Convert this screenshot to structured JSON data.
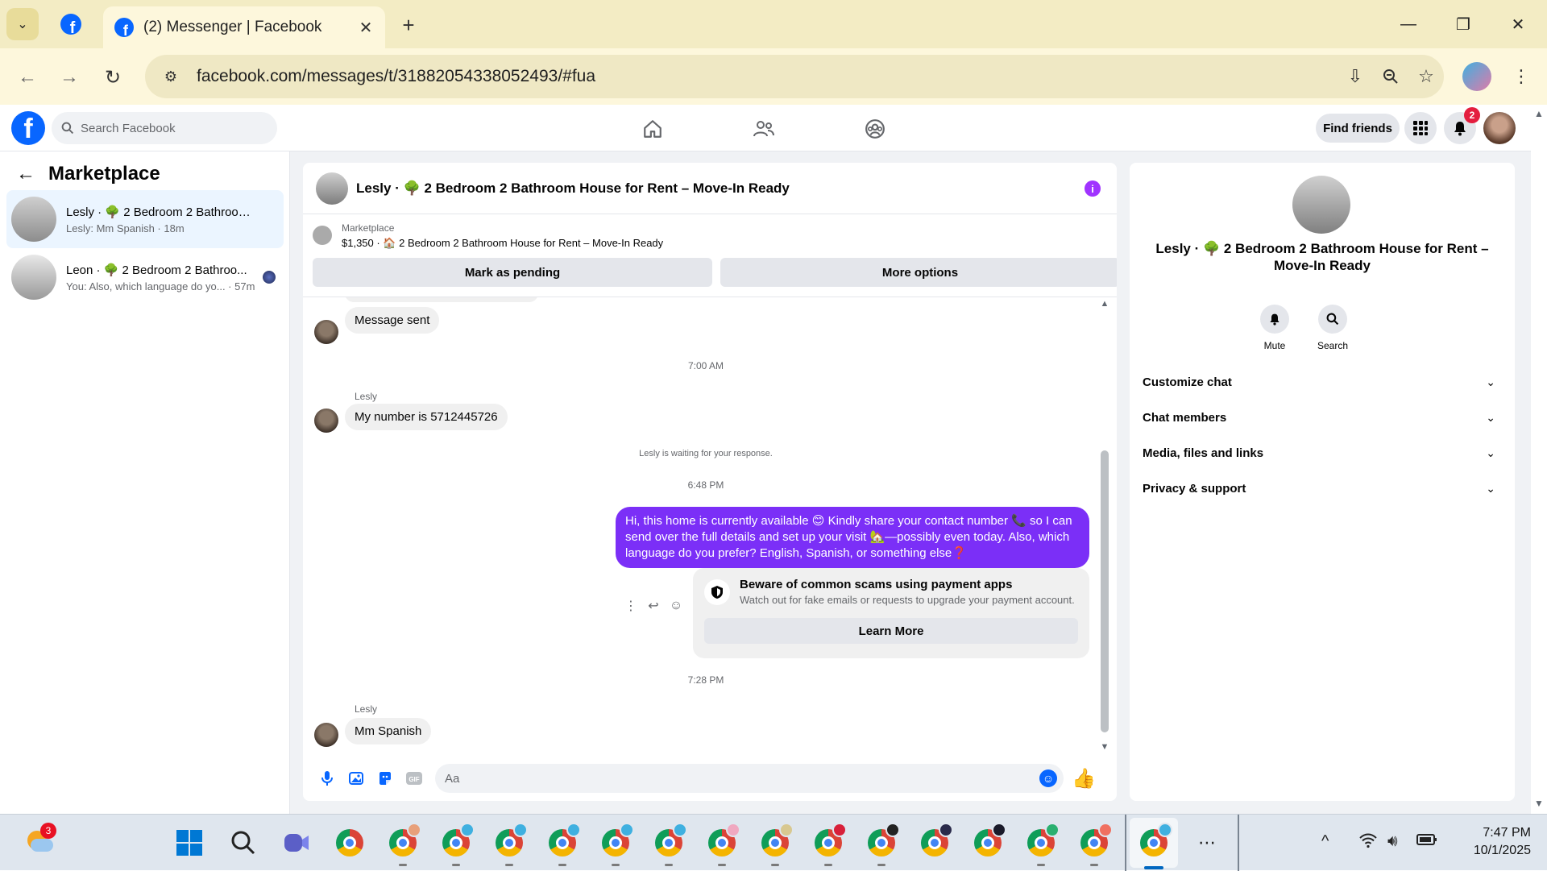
{
  "browser": {
    "tab_title": "(2) Messenger | Facebook",
    "url": "facebook.com/messages/t/31882054338052493/#fua"
  },
  "fb": {
    "search_placeholder": "Search Facebook",
    "find_friends": "Find friends",
    "notif_count": "2"
  },
  "left": {
    "title": "Marketplace",
    "conversations": [
      {
        "name": "Lesly · 🌳 2 Bedroom 2 Bathroom ...",
        "snippet": "Lesly: Mm Spanish · 18m"
      },
      {
        "name": "Leon · 🌳 2 Bedroom 2 Bathroo...",
        "snippet": "You: Also, which language do yo... · 57m"
      }
    ]
  },
  "chat": {
    "header_title": "Lesly · 🌳 2 Bedroom 2 Bathroom House for Rent – Move-In Ready",
    "marketplace_label": "Marketplace",
    "listing": "$1,350 · 🏠 2 Bedroom 2 Bathroom House for Rent – Move-In Ready",
    "mark_pending": "Mark as pending",
    "more_options": "More options",
    "msg_sent": "Message sent",
    "ts1": "7:00 AM",
    "sender": "Lesly",
    "msg_number": "My number is 5712445726",
    "waiting": "Lesly is waiting for your response.",
    "ts2": "6:48 PM",
    "outgoing": "Hi, this home is currently available 😊 Kindly share your contact number 📞 so I can send over the full details and set up your visit 🏡—possibly even today. Also, which language do you prefer? English, Spanish, or something else❓",
    "scam_title": "Beware of common scams using payment apps",
    "scam_sub": "Watch out for fake emails or requests to upgrade your payment account.",
    "learn_more": "Learn More",
    "ts3": "7:28 PM",
    "msg_last": "Mm Spanish",
    "composer_placeholder": "Aa"
  },
  "right": {
    "name": "Lesly · 🌳 2 Bedroom 2 Bathroom House for Rent – Move-In Ready",
    "mute": "Mute",
    "search": "Search",
    "rows": [
      "Customize chat",
      "Chat members",
      "Media, files and links",
      "Privacy & support"
    ]
  },
  "taskbar": {
    "weather_badge": "3",
    "time": "7:47 PM",
    "date": "10/1/2025"
  },
  "colors": {
    "fb_blue": "#0866ff",
    "outgoing_bubble": "#7b2ff7"
  }
}
